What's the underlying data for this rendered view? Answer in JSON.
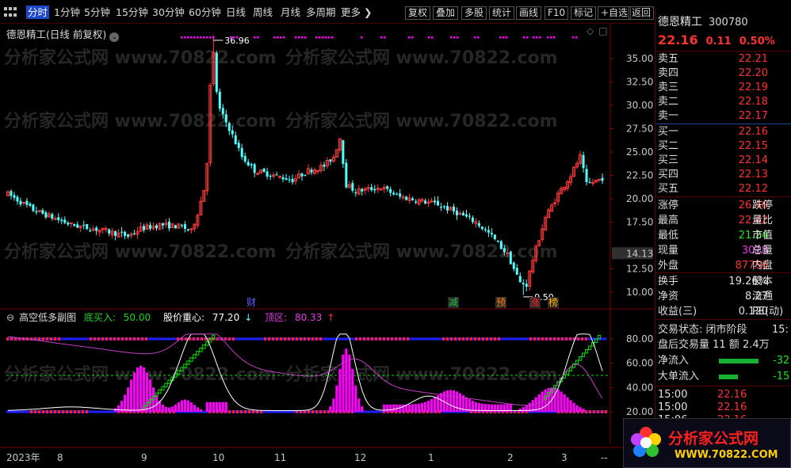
{
  "toolbar": {
    "left": [
      "分时",
      "1分钟",
      "5分钟",
      "15分钟",
      "30分钟",
      "60分钟",
      "日线",
      "周线",
      "月线",
      "多周期",
      "更多"
    ],
    "active_index": 0,
    "right": [
      "复权",
      "叠加",
      "多股",
      "统计",
      "画线",
      "F10",
      "标记",
      "+自选",
      "返回"
    ]
  },
  "chart": {
    "stock_title": "德恩精工(日线 前复权)",
    "high_label": "36.96",
    "low_label": "9.50",
    "price_axis": [
      "35.00",
      "32.50",
      "30.00",
      "27.50",
      "25.00",
      "22.50",
      "20.00",
      "17.50",
      "14.13",
      "12.50",
      "10.00"
    ],
    "markers": [
      "财",
      "减",
      "预",
      "涨",
      "榜"
    ],
    "indicator": {
      "name": "高空低多副图",
      "low_buy_label": "底买入:",
      "low_buy_value": "50.00",
      "center_label": "股价重心:",
      "center_value": "77.20",
      "center_arrow": "↓",
      "top_label": "顶区:",
      "top_value": "80.33",
      "top_arrow": "↑",
      "axis": [
        "80.00",
        "60.00",
        "40.00",
        "20.00"
      ]
    },
    "date_axis": [
      "2023年",
      "8",
      "9",
      "10",
      "11",
      "12",
      "1",
      "2",
      "3",
      "--"
    ],
    "colors": {
      "up": "#ff3c3c",
      "down": "#54ffff",
      "magenta": "#ff00ff",
      "green": "#00dd00",
      "blue": "#2020ff",
      "red_dot": "#ff2020"
    }
  },
  "watermark": "分析家公式网 www.70822.com",
  "quote": {
    "name": "德恩精工",
    "code": "300780",
    "price": "22.16",
    "change": "0.11",
    "pct": "0.50%",
    "asks": [
      {
        "label": "卖五",
        "price": "22.21"
      },
      {
        "label": "卖四",
        "price": "22.20"
      },
      {
        "label": "卖三",
        "price": "22.19"
      },
      {
        "label": "卖二",
        "price": "22.18"
      },
      {
        "label": "卖一",
        "price": "22.17"
      }
    ],
    "bids": [
      {
        "label": "买一",
        "price": "22.16"
      },
      {
        "label": "买二",
        "price": "22.15"
      },
      {
        "label": "买三",
        "price": "22.14"
      },
      {
        "label": "买四",
        "price": "22.13"
      },
      {
        "label": "买五",
        "price": "22.12"
      }
    ],
    "stats": [
      {
        "label": "涨停",
        "value": "26.46",
        "right": "跌停",
        "color": "#ff3232"
      },
      {
        "label": "最高",
        "value": "22.42",
        "right": "量比",
        "color": "#ff3232"
      },
      {
        "label": "最低",
        "value": "21.24",
        "right": "市值",
        "color": "#20e020"
      },
      {
        "label": "现量",
        "value": "3018",
        "right": "总量",
        "color": "#e040e0"
      },
      {
        "label": "外盘",
        "value": "87756",
        "right": "内盘",
        "color": "#ff3232"
      }
    ],
    "stats2": [
      {
        "label": "换手",
        "value": "19.26%",
        "right": "股本",
        "color": "#e0e0e0"
      },
      {
        "label": "净资",
        "value": "8.27",
        "right": "流通",
        "color": "#e0e0e0"
      },
      {
        "label": "收益(三)",
        "value": "0.120",
        "right": "PE(动)",
        "color": "#e0e0e0"
      }
    ],
    "trade_state": "交易状态: 闭市阶段",
    "trade_state_time": "15:",
    "after_hours": "盘后交易量 11 额 2.4万",
    "flows": [
      {
        "label": "净流入",
        "value": "-32"
      },
      {
        "label": "大单流入",
        "value": "-15"
      }
    ],
    "ticks": [
      {
        "time": "15:00",
        "price": "22.16"
      },
      {
        "time": "15:00",
        "price": "22.16"
      },
      {
        "time": "15:06",
        "price": "22.16"
      }
    ]
  },
  "ad": {
    "title": "分析家公式网",
    "url": "WWW.70822.COM"
  }
}
